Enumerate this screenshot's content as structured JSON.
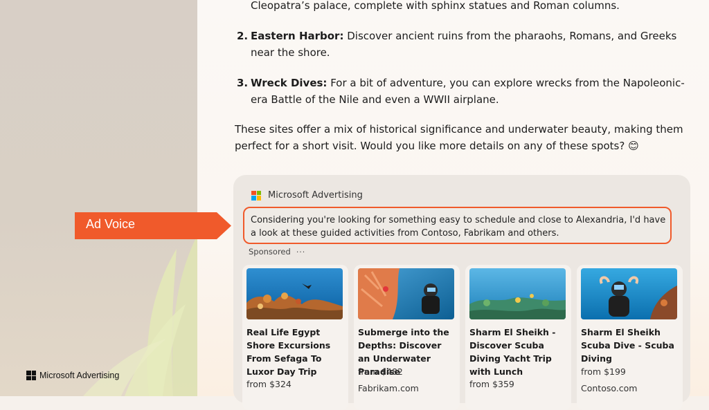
{
  "content": {
    "line0": "Cleopatra’s palace, complete with sphinx statues and Roman columns.",
    "item2": {
      "num": "2.",
      "title": "Eastern Harbor:",
      "text": " Discover ancient ruins from the pharaohs, Romans, and Greeks near the shore."
    },
    "item3": {
      "num": "3.",
      "title": "Wreck Dives:",
      "text": " For a bit of adventure, you can explore wrecks from the Napoleonic-era Battle of the Nile and even a WWII airplane."
    },
    "paragraph": "These sites offer a mix of historical significance and underwater beauty, making them perfect for a short visit. Would you like more details on any of these spots? 😊"
  },
  "ad": {
    "brand": "Microsoft Advertising",
    "voice_text": "Considering you're looking for something easy to schedule and close to Alexandria, I'd have a look at these guided activities from Contoso, Fabrikam and others.",
    "sponsored_label": "Sponsored",
    "more_label": "···",
    "cards": [
      {
        "title": "Real Life Egypt Shore Excursions From Sefaga To Luxor Day Trip",
        "price": "from $324",
        "domain": ""
      },
      {
        "title": "Submerge into the Depths: Discover an Underwater Paradise",
        "price": "from $482",
        "domain": "Fabrikam.com"
      },
      {
        "title": "Sharm El Sheikh - Discover Scuba Diving Yacht Trip with Lunch",
        "price": "from $359",
        "domain": ""
      },
      {
        "title": "Sharm El Sheikh Scuba Dive - Scuba Diving",
        "price": "from $199",
        "domain": "Contoso.com"
      }
    ]
  },
  "callout": {
    "label": "Ad Voice"
  },
  "footer": {
    "brand": "Microsoft Advertising"
  },
  "colors": {
    "accent": "#f05a2b",
    "card_bg": "#ece7e2"
  }
}
